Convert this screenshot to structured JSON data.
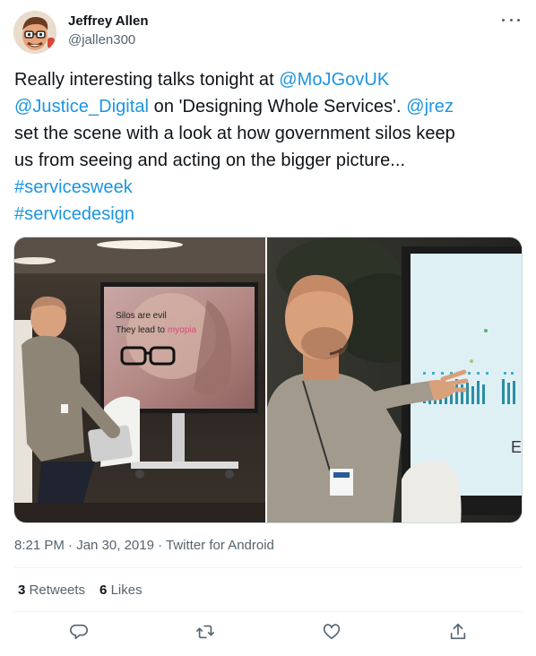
{
  "author": {
    "name": "Jeffrey Allen",
    "handle": "@jallen300"
  },
  "tweet": {
    "line1_plain": "Really interesting talks tonight at ",
    "mention_mojgovuk": "@MoJGovUK",
    "mention_justice_digital": "@Justice_Digital",
    "line2_plain": " on 'Designing Whole Services'. ",
    "mention_jrez": "@jrez",
    "line3": "set the scene with a look at how government silos keep",
    "line4": "us from seeing and acting on the bigger picture...",
    "hashtag1": "#servicesweek",
    "hashtag2": "#servicedesign"
  },
  "media": {
    "screen_text_line1": "Silos are evil",
    "screen_text_line2_a": "They lead to ",
    "screen_text_line2_b": "myopia"
  },
  "meta": {
    "timestamp": "8:21 PM · Jan 30, 2019",
    "separator": " · ",
    "source": "Twitter for Android"
  },
  "stats": {
    "retweets_count": "3",
    "retweets_label": "Retweets",
    "likes_count": "6",
    "likes_label": "Likes"
  },
  "icons": {
    "reply": "reply-icon",
    "retweet": "retweet-icon",
    "like": "like-icon",
    "share": "share-icon",
    "more": "more-icon"
  },
  "colors": {
    "link": "#1b95e0",
    "text": "#0f1419",
    "secondary": "#536471",
    "border": "#eff3f4"
  }
}
